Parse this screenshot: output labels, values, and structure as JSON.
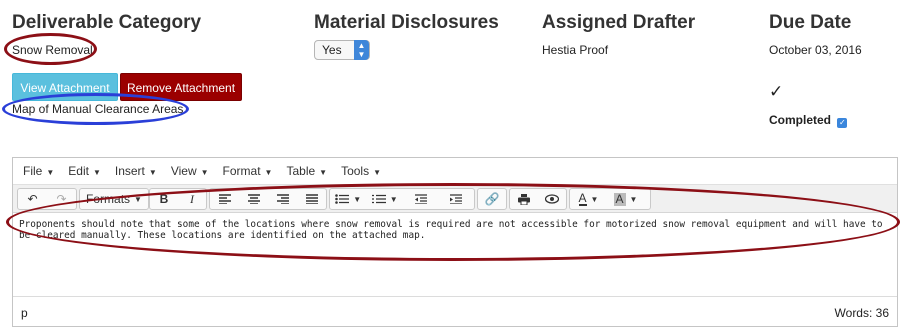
{
  "deliverable": {
    "heading": "Deliverable Category",
    "value": "Snow Removal",
    "view_button": "View Attachment",
    "remove_button": "Remove Attachment",
    "attachment_name": "Map of Manual Clearance Areas"
  },
  "material": {
    "heading": "Material Disclosures",
    "selected": "Yes"
  },
  "drafter": {
    "heading": "Assigned Drafter",
    "value": "Hestia Proof"
  },
  "due": {
    "heading": "Due Date",
    "value": "October 03, 2016",
    "checkmark": "✓",
    "completed_label": "Completed"
  },
  "editor": {
    "menu": [
      "File",
      "Edit",
      "Insert",
      "View",
      "Format",
      "Table",
      "Tools"
    ],
    "formats_label": "Formats",
    "content": "Proponents should note that some of the locations where snow removal is required are not accessible for motorized snow removal equipment and will have to be cleared manually. These locations are identified on the attached map.",
    "path": "p",
    "word_count": "Words: 36"
  },
  "colors": {
    "annotation_red": "#8c0f16",
    "annotation_blue": "#2a3fd8",
    "view_button": "#5bc0de",
    "remove_button": "#9b0000"
  }
}
